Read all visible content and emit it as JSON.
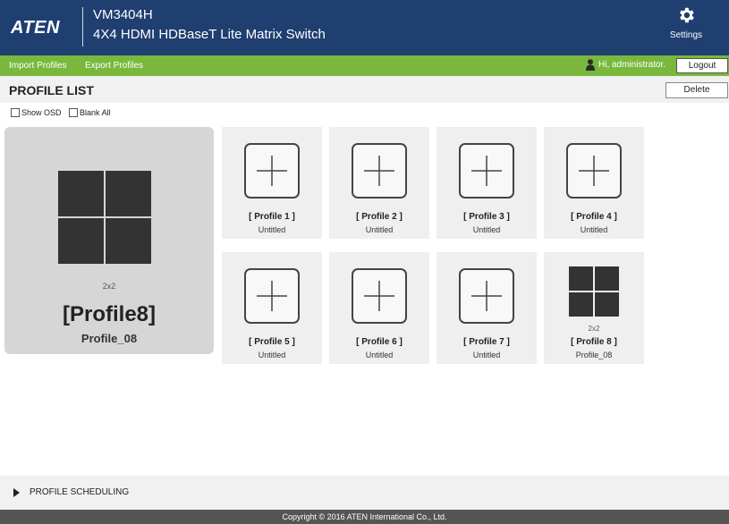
{
  "header": {
    "logo": "ATEN",
    "model": "VM3404H",
    "subtitle": "4X4 HDMI HDBaseT Lite Matrix Switch",
    "settings_label": "Settings"
  },
  "menubar": {
    "items": [
      "Import Profiles",
      "Export Profiles"
    ],
    "user_greeting": "Hi, administrator.",
    "logout_label": "Logout"
  },
  "page": {
    "title": "PROFILE LIST",
    "delete_label": "Delete",
    "show_osd_label": "Show OSD",
    "blank_all_label": "Blank All"
  },
  "preview": {
    "layout": "2x2",
    "name": "[Profile8]",
    "subtitle": "Profile_08"
  },
  "profiles": [
    {
      "name": "[ Profile 1 ]",
      "subtitle": "Untitled"
    },
    {
      "name": "[ Profile 2 ]",
      "subtitle": "Untitled"
    },
    {
      "name": "[ Profile 3 ]",
      "subtitle": "Untitled"
    },
    {
      "name": "[ Profile 4 ]",
      "subtitle": "Untitled"
    },
    {
      "name": "[ Profile 5 ]",
      "subtitle": "Untitled"
    },
    {
      "name": "[ Profile 6 ]",
      "subtitle": "Untitled"
    },
    {
      "name": "[ Profile 7 ]",
      "subtitle": "Untitled"
    },
    {
      "name": "[ Profile 8 ]",
      "subtitle": "Profile_08",
      "layout": "2x2"
    }
  ],
  "scheduling": {
    "label": "PROFILE SCHEDULING"
  },
  "footer": {
    "copyright": "Copyright © 2016 ATEN International Co., Ltd."
  },
  "colors": {
    "header": "#1f3f70",
    "menubar": "#79b83d",
    "footer": "#555555"
  }
}
